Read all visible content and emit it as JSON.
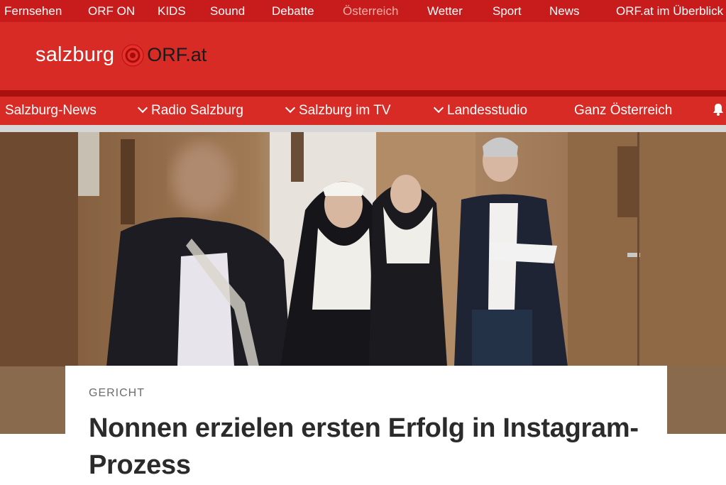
{
  "topnav": {
    "items": [
      "Fernsehen",
      "ORF ON",
      "KIDS",
      "Sound",
      "Debatte",
      "Österreich",
      "Wetter",
      "Sport",
      "News",
      "ORF.at im Überblick"
    ],
    "active_index": 5
  },
  "header": {
    "region": "salzburg",
    "orf": "ORF",
    "tld": ".at",
    "logo_icon": "orf-eye-icon"
  },
  "sectionnav": {
    "items": [
      {
        "label": "Salzburg-News",
        "dropdown": false
      },
      {
        "label": "Radio Salzburg",
        "dropdown": true
      },
      {
        "label": "Salzburg im TV",
        "dropdown": true
      },
      {
        "label": "Landesstudio",
        "dropdown": true
      },
      {
        "label": "Ganz Österreich",
        "dropdown": false
      }
    ],
    "bell_icon": "bell-icon"
  },
  "article": {
    "kicker": "GERICHT",
    "headline": "Nonnen erzielen ersten Erfolg in Instagram-Prozess"
  },
  "colors": {
    "topnav_bg": "#c81b1b",
    "header_bg": "#d92b26",
    "divider": "#a9100f",
    "active_nav": "#f4b0a8"
  }
}
